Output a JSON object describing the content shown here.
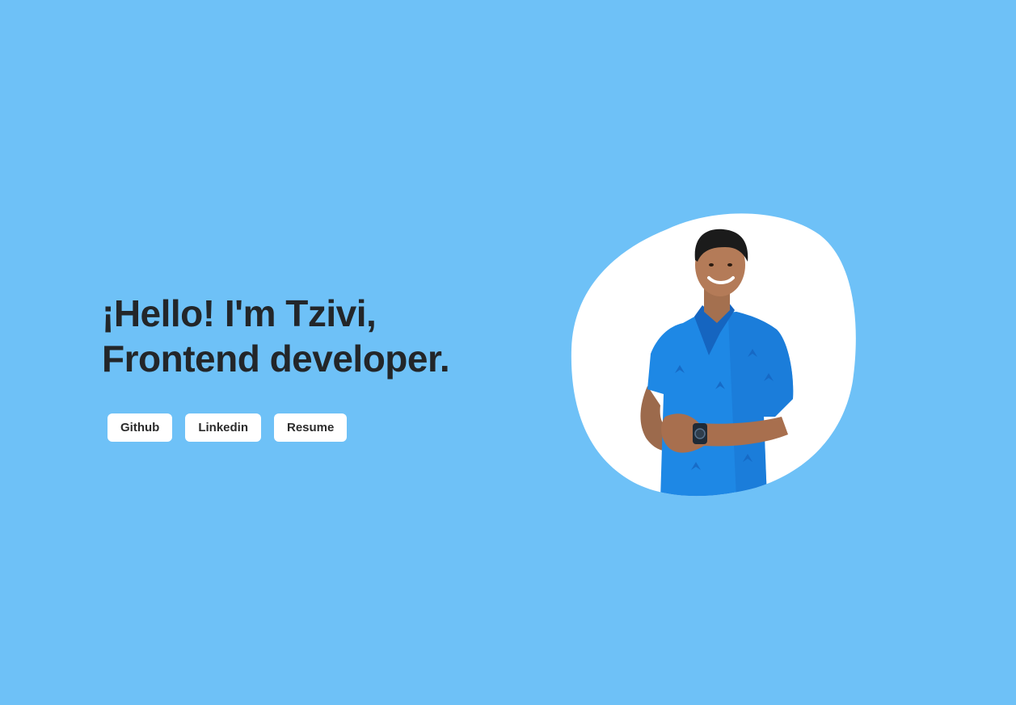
{
  "hero": {
    "headline_line1": "¡Hello! I'm Tzivi,",
    "headline_line2": "Frontend developer."
  },
  "links": [
    {
      "label": "Github"
    },
    {
      "label": "Linkedin"
    },
    {
      "label": "Resume"
    }
  ],
  "colors": {
    "background": "#6ec1f7",
    "headline": "#232629",
    "button_bg": "#ffffff",
    "shirt": "#1e88e5"
  }
}
